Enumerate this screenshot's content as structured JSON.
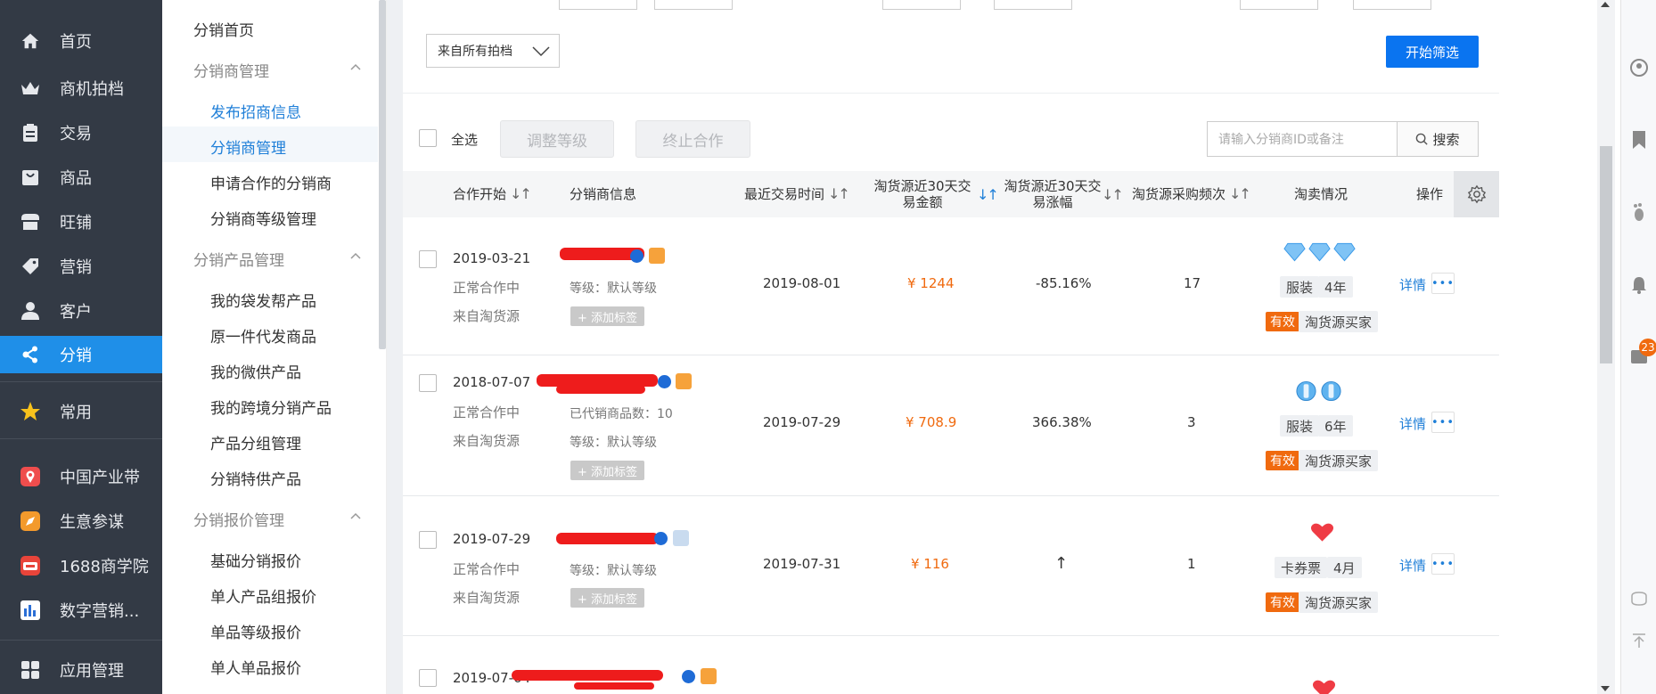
{
  "nav": {
    "items": [
      {
        "label": "首页",
        "icon": "home-icon"
      },
      {
        "label": "商机拍档",
        "icon": "crown-icon"
      },
      {
        "label": "交易",
        "icon": "clipboard-icon"
      },
      {
        "label": "商品",
        "icon": "bag-icon"
      },
      {
        "label": "旺铺",
        "icon": "store-icon"
      },
      {
        "label": "营销",
        "icon": "tag-icon"
      },
      {
        "label": "客户",
        "icon": "user-icon"
      },
      {
        "label": "分销",
        "icon": "distribution-icon"
      },
      {
        "label": "常用",
        "icon": "star-icon"
      },
      {
        "label": "中国产业带",
        "icon": "location-pin-icon"
      },
      {
        "label": "生意参谋",
        "icon": "compass-icon"
      },
      {
        "label": "1688商学院",
        "icon": "school-icon"
      },
      {
        "label": "数字营销...",
        "icon": "chart-app-icon"
      },
      {
        "label": "应用管理",
        "icon": "apps-grid-icon"
      }
    ]
  },
  "sidebar": {
    "home": "分销首页",
    "group1": "分销商管理",
    "group1_items": [
      "发布招商信息",
      "分销商管理",
      "申请合作的分销商",
      "分销商等级管理"
    ],
    "group2": "分销产品管理",
    "group2_items": [
      "我的袋发帮产品",
      "原一件代发商品",
      "我的微供产品",
      "我的跨境分销产品",
      "产品分组管理",
      "分销特供产品"
    ],
    "group3": "分销报价管理",
    "group3_items": [
      "基础分销报价",
      "单人产品组报价",
      "单品等级报价",
      "单人单品报价"
    ]
  },
  "filter": {
    "source_select": "来自所有拍档",
    "start_button": "开始筛选"
  },
  "toolbar": {
    "select_all": "全选",
    "adjust_level": "调整等级",
    "end_coop": "终止合作",
    "search_placeholder": "请输入分销商ID或备注",
    "search_button": "搜索"
  },
  "table": {
    "headers": {
      "coop_start": "合作开始",
      "distributor_info": "分销商信息",
      "last_trade": "最近交易时间",
      "amount_30d_l1": "淘货源近30天交",
      "amount_30d_l2": "易金额",
      "growth_30d_l1": "淘货源近30天交",
      "growth_30d_l2": "易涨幅",
      "frequency": "淘货源采购频次",
      "taomai": "淘卖情况",
      "action": "操作"
    },
    "rows": [
      {
        "date": "2019-03-21",
        "status": "正常合作中",
        "source": "来自淘货源",
        "products": "",
        "level": "等级：默认等级",
        "add_tag": "+ 添加标签",
        "last_trade": "2019-08-01",
        "amount": "¥ 1244",
        "growth": "-85.16%",
        "frequency": "17",
        "rank_icon": "diamond",
        "rank_count": 3,
        "category": "服装",
        "years": "4年",
        "valid": "有效",
        "buyer": "淘货源买家",
        "detail": "详情"
      },
      {
        "date": "2018-07-07",
        "status": "正常合作中",
        "source": "来自淘货源",
        "products": "已代销商品数：10",
        "level": "等级：默认等级",
        "add_tag": "+ 添加标签",
        "last_trade": "2019-07-29",
        "amount": "¥ 708.9",
        "growth": "366.38%",
        "frequency": "3",
        "rank_icon": "crown",
        "rank_count": 2,
        "category": "服装",
        "years": "6年",
        "valid": "有效",
        "buyer": "淘货源买家",
        "detail": "详情"
      },
      {
        "date": "2019-07-29",
        "status": "正常合作中",
        "source": "来自淘货源",
        "products": "",
        "level": "等级：默认等级",
        "add_tag": "+ 添加标签",
        "last_trade": "2019-07-31",
        "amount": "¥ 116",
        "growth": "↑",
        "frequency": "1",
        "rank_icon": "heart",
        "rank_count": 1,
        "category": "卡券票",
        "years": "4月",
        "valid": "有效",
        "buyer": "淘货源买家",
        "detail": "详情"
      },
      {
        "date": "2019-07-04"
      }
    ]
  },
  "right_panel": {
    "badge": "23"
  },
  "colors": {
    "nav_bg": "#333a45",
    "active_blue": "#1f8fe8",
    "primary_button": "#0a74f0",
    "orange": "#f06a0f",
    "link_blue": "#1f7fd8"
  }
}
